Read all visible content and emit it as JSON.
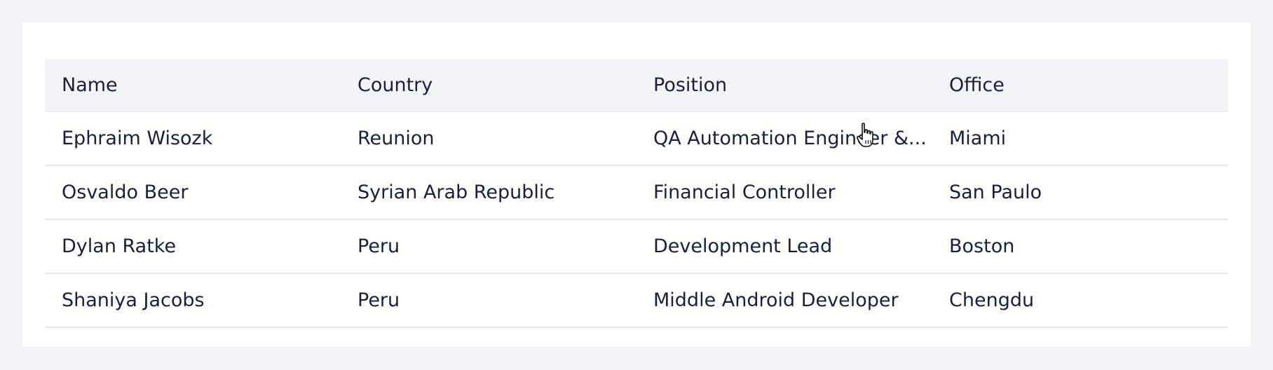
{
  "table": {
    "headers": [
      "Name",
      "Country",
      "Position",
      "Office"
    ],
    "rows": [
      [
        "Ephraim Wisozk",
        "Reunion",
        "QA Automation Engineer &...",
        "Miami"
      ],
      [
        "Osvaldo Beer",
        "Syrian Arab Republic",
        "Financial Controller",
        "San Paulo"
      ],
      [
        "Dylan Ratke",
        "Peru",
        "Development Lead",
        "Boston"
      ],
      [
        "Shaniya Jacobs",
        "Peru",
        "Middle Android Developer",
        "Chengdu"
      ]
    ]
  },
  "icons": {
    "cursor": "hand-pointer-icon"
  }
}
